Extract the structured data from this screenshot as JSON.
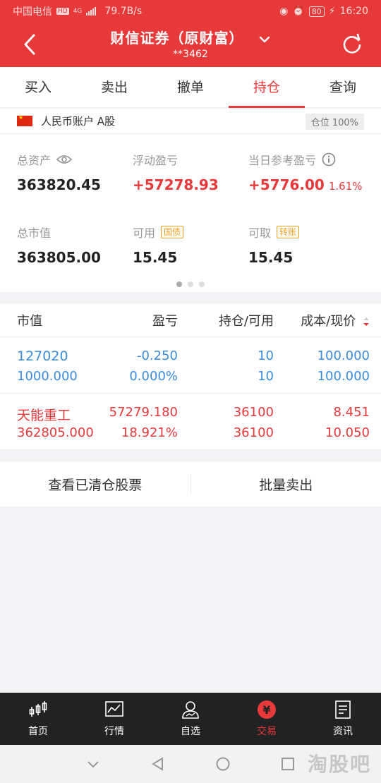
{
  "statusbar": {
    "carrier": "中国电信",
    "net_badge": "HD",
    "net_type": "4G",
    "speed": "79.7B/s",
    "battery": "80",
    "time": "16:20"
  },
  "header": {
    "title": "财信证券（原财富）",
    "account_masked": "**3462"
  },
  "tabs": [
    {
      "label": "买入"
    },
    {
      "label": "卖出"
    },
    {
      "label": "撤单"
    },
    {
      "label": "持仓",
      "active": true
    },
    {
      "label": "查询"
    }
  ],
  "account": {
    "name": "人民币账户 A股",
    "position_ratio": "仓位 100%",
    "total_assets_label": "总资产",
    "total_assets": "363820.45",
    "float_pl_label": "浮动盈亏",
    "float_pl": "+57278.93",
    "daily_pl_label": "当日参考盈亏",
    "daily_pl": "+5776.00",
    "daily_pl_pct": "1.61%",
    "market_value_label": "总市值",
    "market_value": "363805.00",
    "available_label": "可用",
    "available_tag": "国债",
    "available": "15.45",
    "withdrawable_label": "可取",
    "withdrawable_tag": "转账",
    "withdrawable": "15.45"
  },
  "table": {
    "headers": {
      "market_value": "市值",
      "pl": "盈亏",
      "position": "持仓/可用",
      "cost": "成本/现价"
    },
    "rows": [
      {
        "name": "127020",
        "market_value": "1000.000",
        "pl": "-0.250",
        "pl_pct": "0.000%",
        "position": "10",
        "available": "10",
        "cost": "100.000",
        "price": "100.000",
        "color": "#3a8bdc"
      },
      {
        "name": "天能重工",
        "market_value": "362805.000",
        "pl": "57279.180",
        "pl_pct": "18.921%",
        "position": "36100",
        "available": "36100",
        "cost": "8.451",
        "price": "10.050",
        "color": "#e8393a"
      }
    ]
  },
  "actions": {
    "view_cleared": "查看已清仓股票",
    "batch_sell": "批量卖出"
  },
  "bottom_nav": [
    {
      "label": "首页",
      "icon": "home-chart-icon"
    },
    {
      "label": "行情",
      "icon": "market-icon"
    },
    {
      "label": "自选",
      "icon": "watchlist-icon"
    },
    {
      "label": "交易",
      "icon": "trade-yen-icon",
      "active": true
    },
    {
      "label": "资讯",
      "icon": "news-icon"
    }
  ],
  "watermark": "淘股吧",
  "colors": {
    "brand": "#e8393a",
    "rise": "#e8393a",
    "flat": "#3a8bdc"
  }
}
